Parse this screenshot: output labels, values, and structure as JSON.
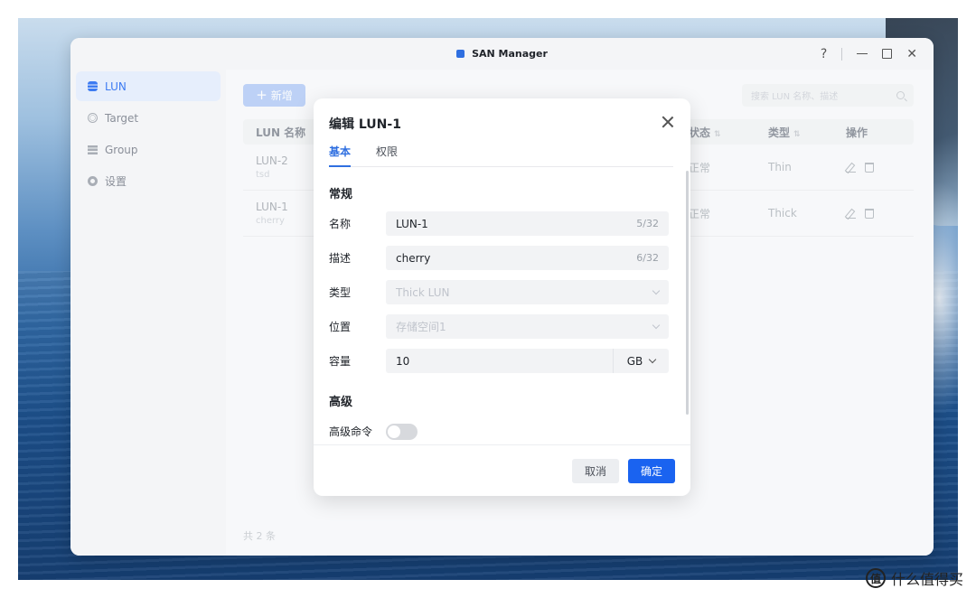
{
  "window": {
    "title": "SAN Manager",
    "help": "?"
  },
  "sidebar": {
    "items": [
      {
        "label": "LUN",
        "icon": "database-icon",
        "active": true
      },
      {
        "label": "Target",
        "icon": "globe-icon",
        "active": false
      },
      {
        "label": "Group",
        "icon": "list-icon",
        "active": false
      },
      {
        "label": "设置",
        "icon": "gear-icon",
        "active": false
      }
    ]
  },
  "toolbar": {
    "add_label": "新增",
    "search_placeholder": "搜索 LUN 名称、描述"
  },
  "table": {
    "headers": {
      "name": "LUN 名称",
      "status": "状态",
      "type": "类型",
      "ops": "操作"
    },
    "rows": [
      {
        "name": "LUN-2",
        "desc": "tsd",
        "status": "正常",
        "type": "Thin"
      },
      {
        "name": "LUN-1",
        "desc": "cherry",
        "status": "正常",
        "type": "Thick"
      }
    ],
    "total": "共 2 条"
  },
  "dialog": {
    "title": "编辑 LUN-1",
    "tabs": [
      {
        "label": "基本",
        "active": true
      },
      {
        "label": "权限",
        "active": false
      }
    ],
    "sections": {
      "general": "常规",
      "advanced": "高级"
    },
    "fields": {
      "name": {
        "label": "名称",
        "value": "LUN-1",
        "counter": "5/32"
      },
      "desc": {
        "label": "描述",
        "value": "cherry",
        "counter": "6/32"
      },
      "type": {
        "label": "类型",
        "value": "Thick LUN"
      },
      "location": {
        "label": "位置",
        "value": "存储空间1"
      },
      "capacity": {
        "label": "容量",
        "value": "10",
        "unit": "GB"
      },
      "adv_cmd": {
        "label": "高级命令",
        "enabled": false
      }
    },
    "buttons": {
      "cancel": "取消",
      "ok": "确定"
    }
  },
  "watermark": {
    "badge": "值",
    "text": "什么值得买"
  },
  "colors": {
    "accent": "#1a63f0",
    "sidebar_active_bg": "#e6eefc",
    "add_button": "#9ebcf5"
  }
}
